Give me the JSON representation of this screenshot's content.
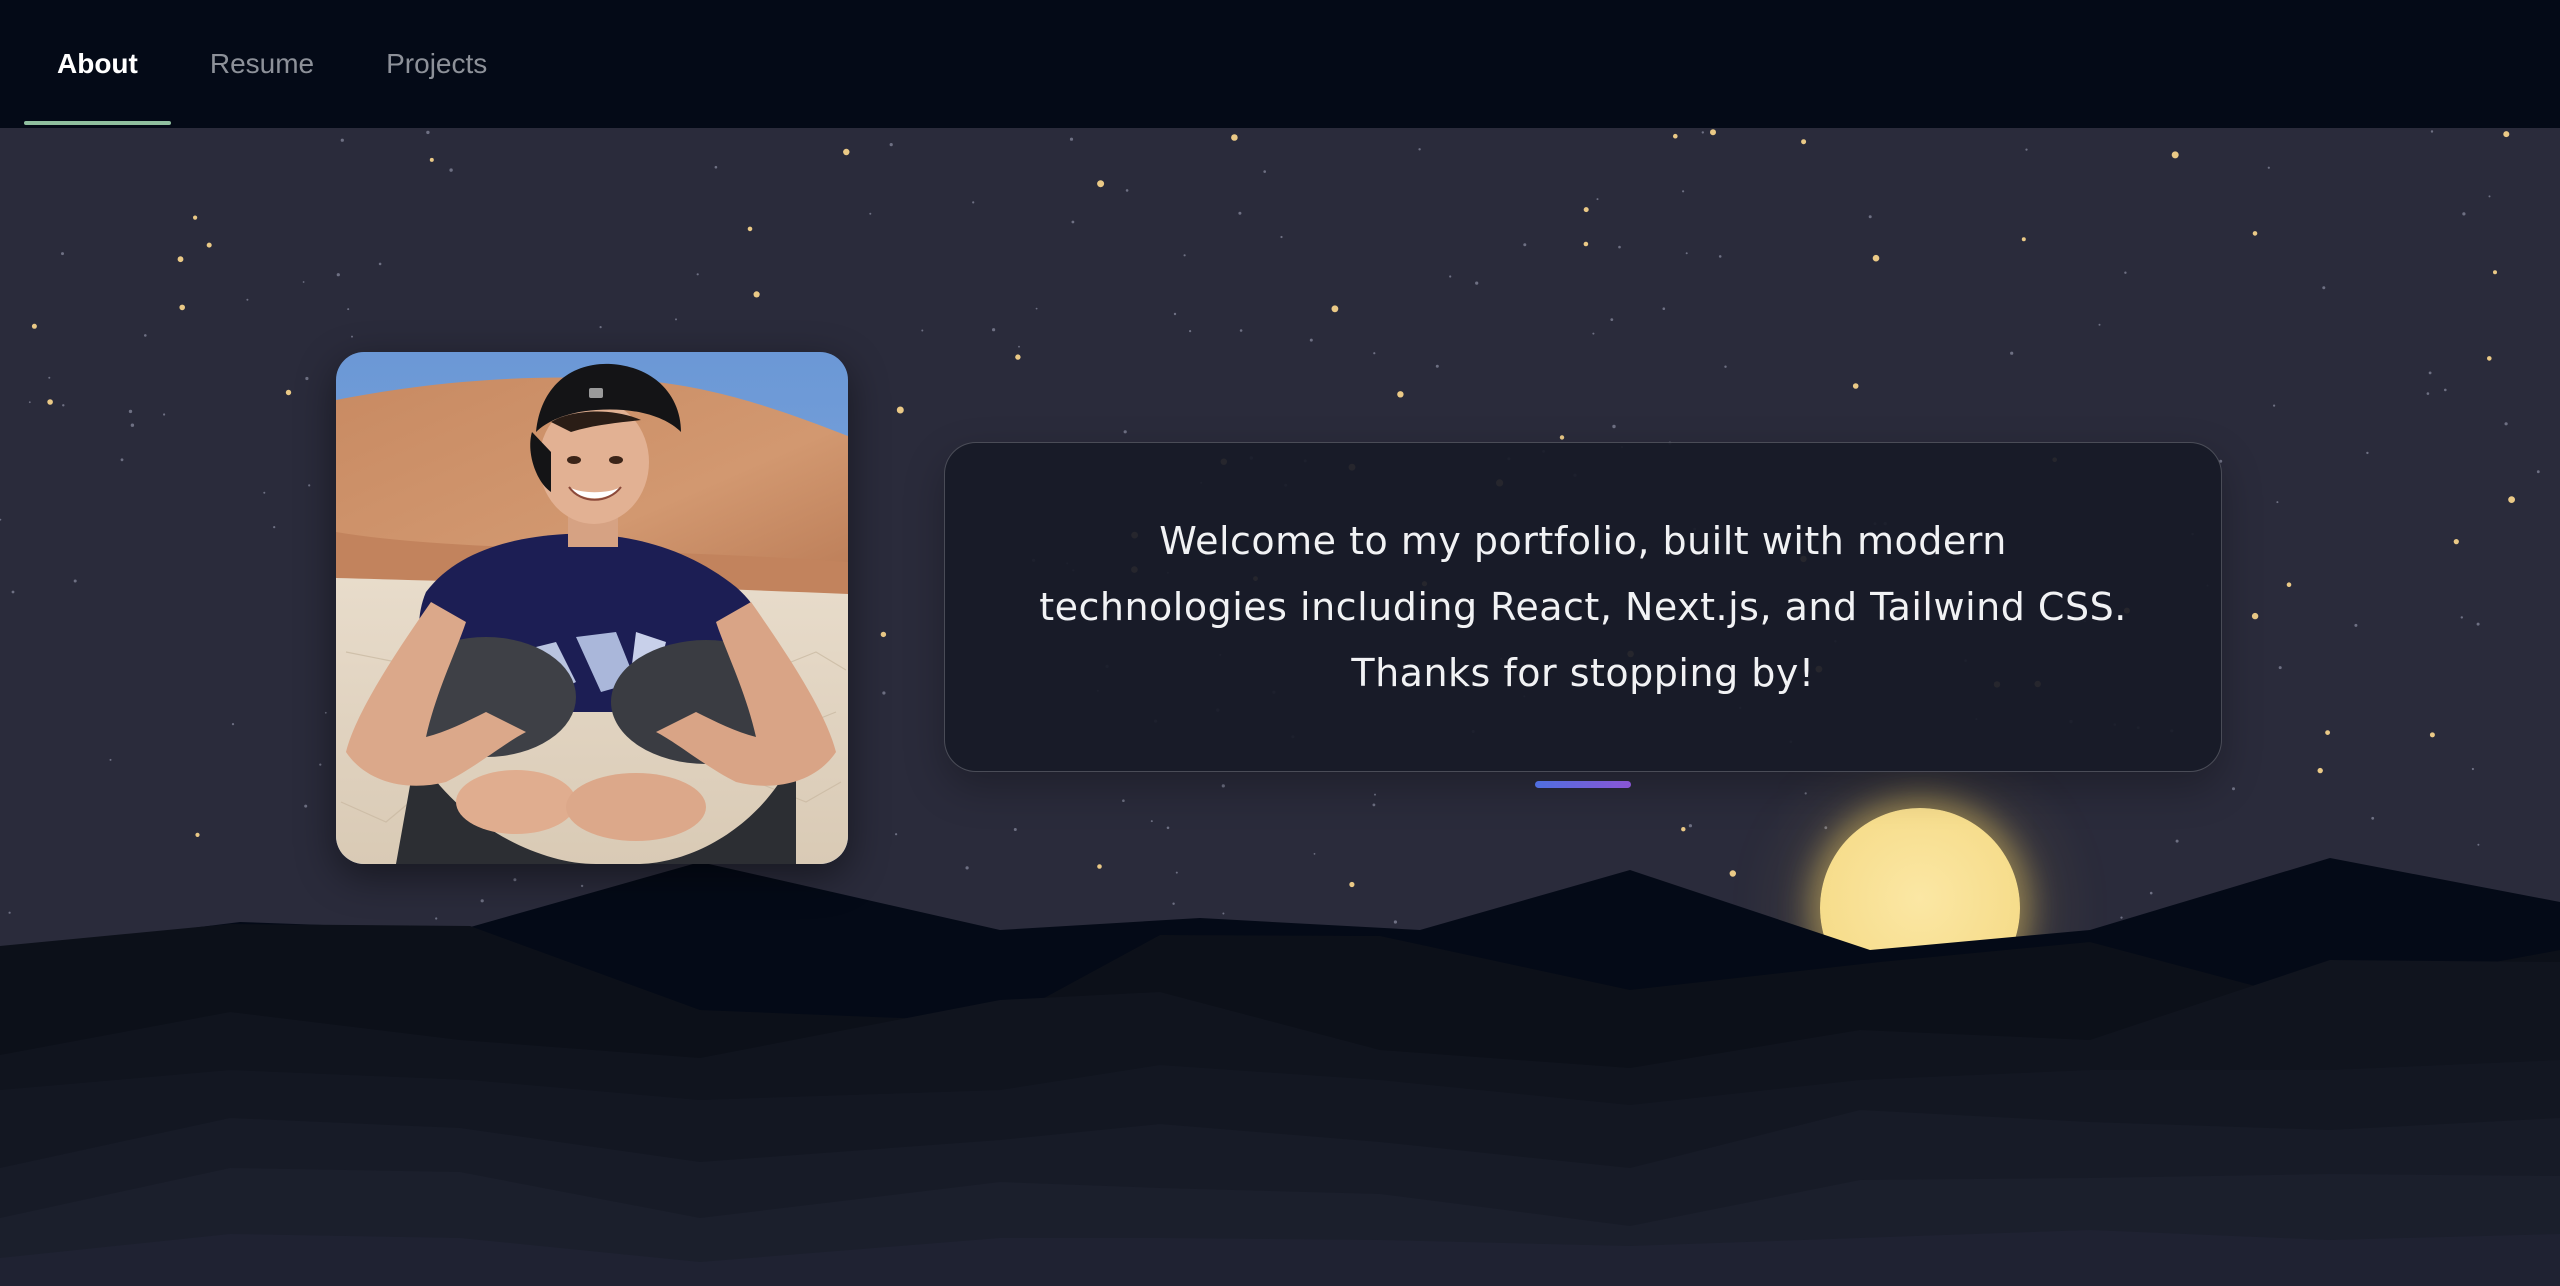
{
  "nav": {
    "tabs": [
      {
        "label": "About",
        "active": true
      },
      {
        "label": "Resume",
        "active": false
      },
      {
        "label": "Projects",
        "active": false
      }
    ],
    "active_underline_color": "#8fbf9f"
  },
  "hero": {
    "welcome_text": "Welcome to my portfolio, built with modern technologies including React, Next.js, and Tailwind CSS. Thanks for stopping by!",
    "profile_photo": "portrait-photo"
  },
  "colors": {
    "header_bg": "#040a17",
    "sky": "#2a2b3b",
    "moon": "#f6dc8a",
    "accent_gradient_start": "#4f6fe0",
    "accent_gradient_end": "#8a55d6"
  },
  "decor": {
    "background_icon": "starry-night-icon",
    "moon_icon": "moon-icon",
    "mountains_icon": "mountain-range-icon"
  }
}
